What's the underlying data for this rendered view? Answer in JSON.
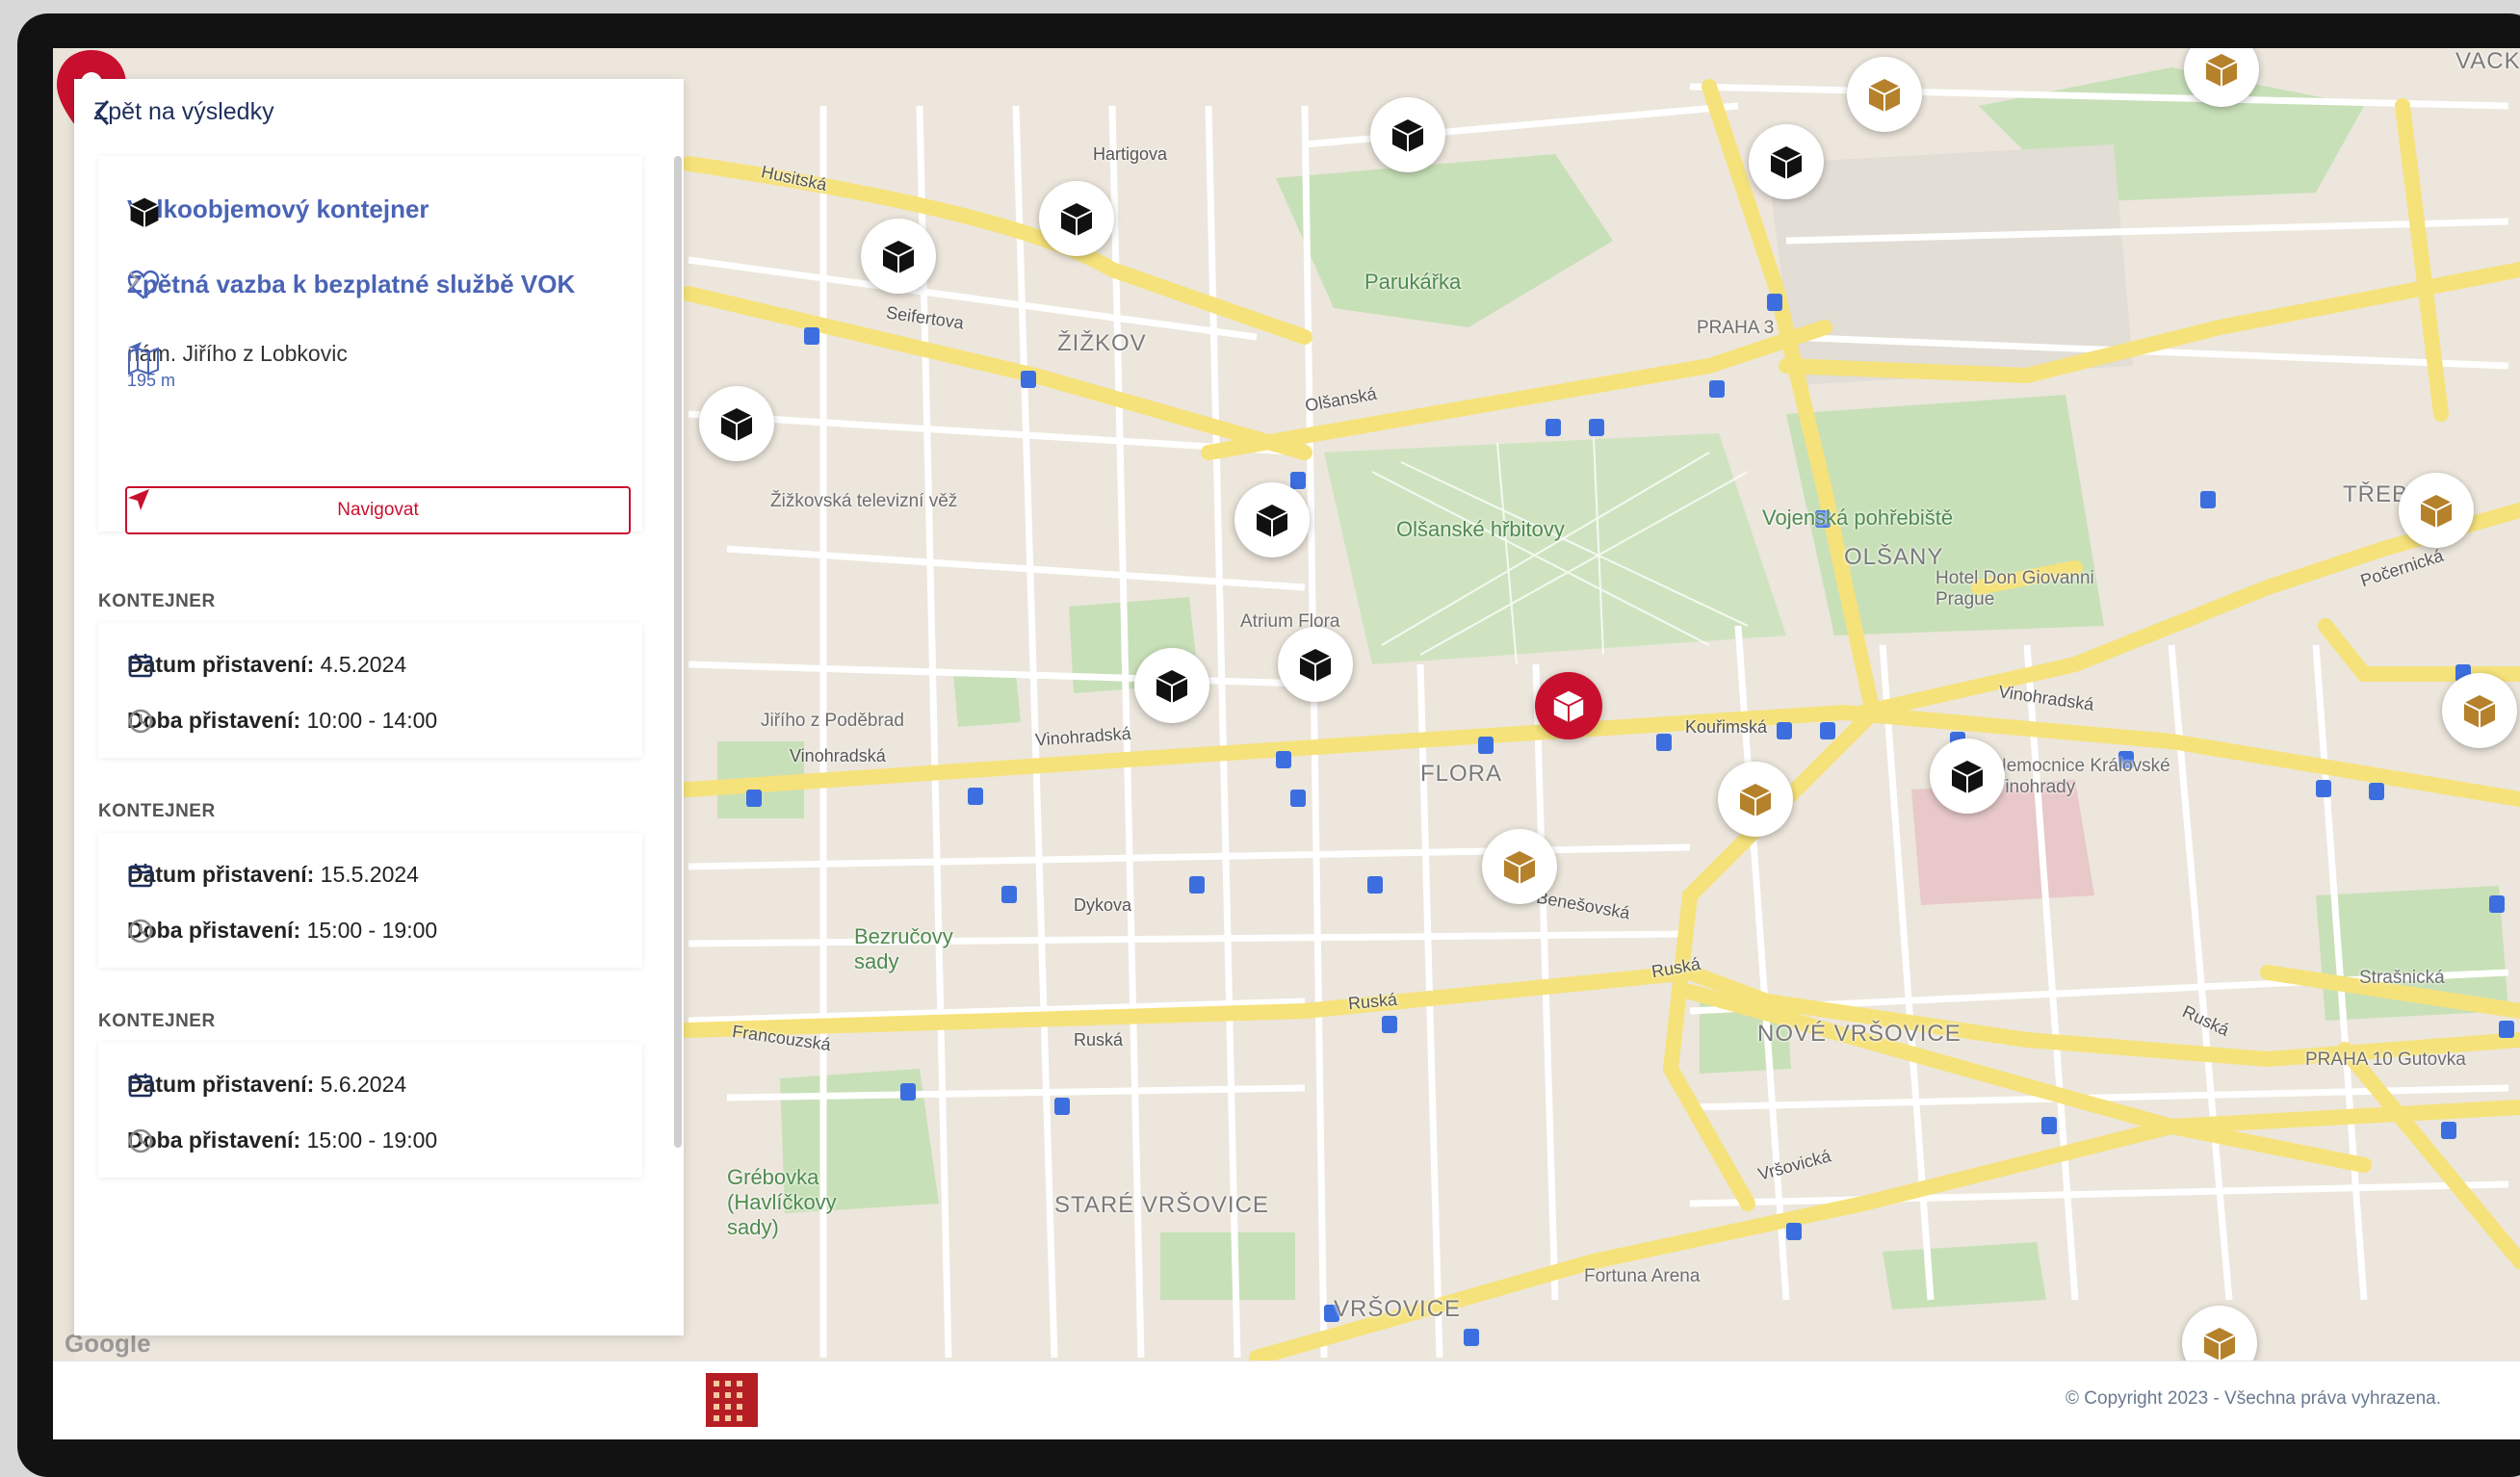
{
  "panel": {
    "back_label": "Zpět na výsledky",
    "title": "Velkoobjemový kontejner",
    "feedback_link": "Zpětná vazba k bezplatné službě VOK",
    "address": "nám. Jiřího z Lobkovic",
    "distance": "195 m",
    "navigate_label": "Navigovat"
  },
  "containers": [
    {
      "header": "KONTEJNER",
      "date_label": "Datum přistavení:",
      "date": "4.5.2024",
      "time_label": "Doba přistavení:",
      "time": "10:00 - 14:00"
    },
    {
      "header": "KONTEJNER",
      "date_label": "Datum přistavení:",
      "date": "15.5.2024",
      "time_label": "Doba přistavení:",
      "time": "15:00 - 19:00"
    },
    {
      "header": "KONTEJNER",
      "date_label": "Datum přistavení:",
      "date": "5.6.2024",
      "time_label": "Doba přistavení:",
      "time": "15:00 - 19:00"
    }
  ],
  "map": {
    "labels": {
      "zizkov": "ŽIŽKOV",
      "olsany": "OLŠANY",
      "flora": "FLORA",
      "trebesin": "TŘEBESÍN",
      "nove_vrsovice": "NOVÉ VRŠOVICE",
      "stare_vrsovice": "STARÉ VRŠOVICE",
      "vrsovice": "VRŠOVICE",
      "vackov": "VACKOV",
      "praha3": "PRAHA 3",
      "praha10": "PRAHA 10",
      "parukarka": "Parukářka",
      "olsanske": "Olšanské hřbitovy",
      "vojenska": "Vojenská pohřebiště",
      "atrium": "Atrium Flora",
      "tower": "Žižkovská televizní věž",
      "jiriho": "Jiřího z Poděbrad",
      "bezrucovy": "Bezručovy sady",
      "grebovka": "Grébovka (Havlíčkovy sady)",
      "hotel": "Hotel Don Giovanni Prague",
      "nemocnice": "Nemocnice Královské Vinohrady",
      "fortuna": "Fortuna Arena",
      "strasnicka": "Strašnická",
      "gutovka": "Gutovka",
      "vinohradska": "Vinohradská",
      "olsanska": "Olšanská",
      "ruska": "Ruská",
      "seifertova": "Seifertova",
      "husitska": "Husitská",
      "francouzska": "Francouzská",
      "pocernicka": "Počernická",
      "vrsovicka": "Vršovická",
      "hartigova": "Hartigova",
      "dykova": "Dykova",
      "kourimska": "Kouřimská",
      "benesovska": "Benešovská"
    },
    "google_logo": "Google"
  },
  "footer": {
    "copyright": "© Copyright 2023 - Všechna práva vyhrazena."
  },
  "colors": {
    "accent": "#c8102e",
    "link": "#4a64b5",
    "container_black": "#111111",
    "container_brown": "#b5812b"
  }
}
